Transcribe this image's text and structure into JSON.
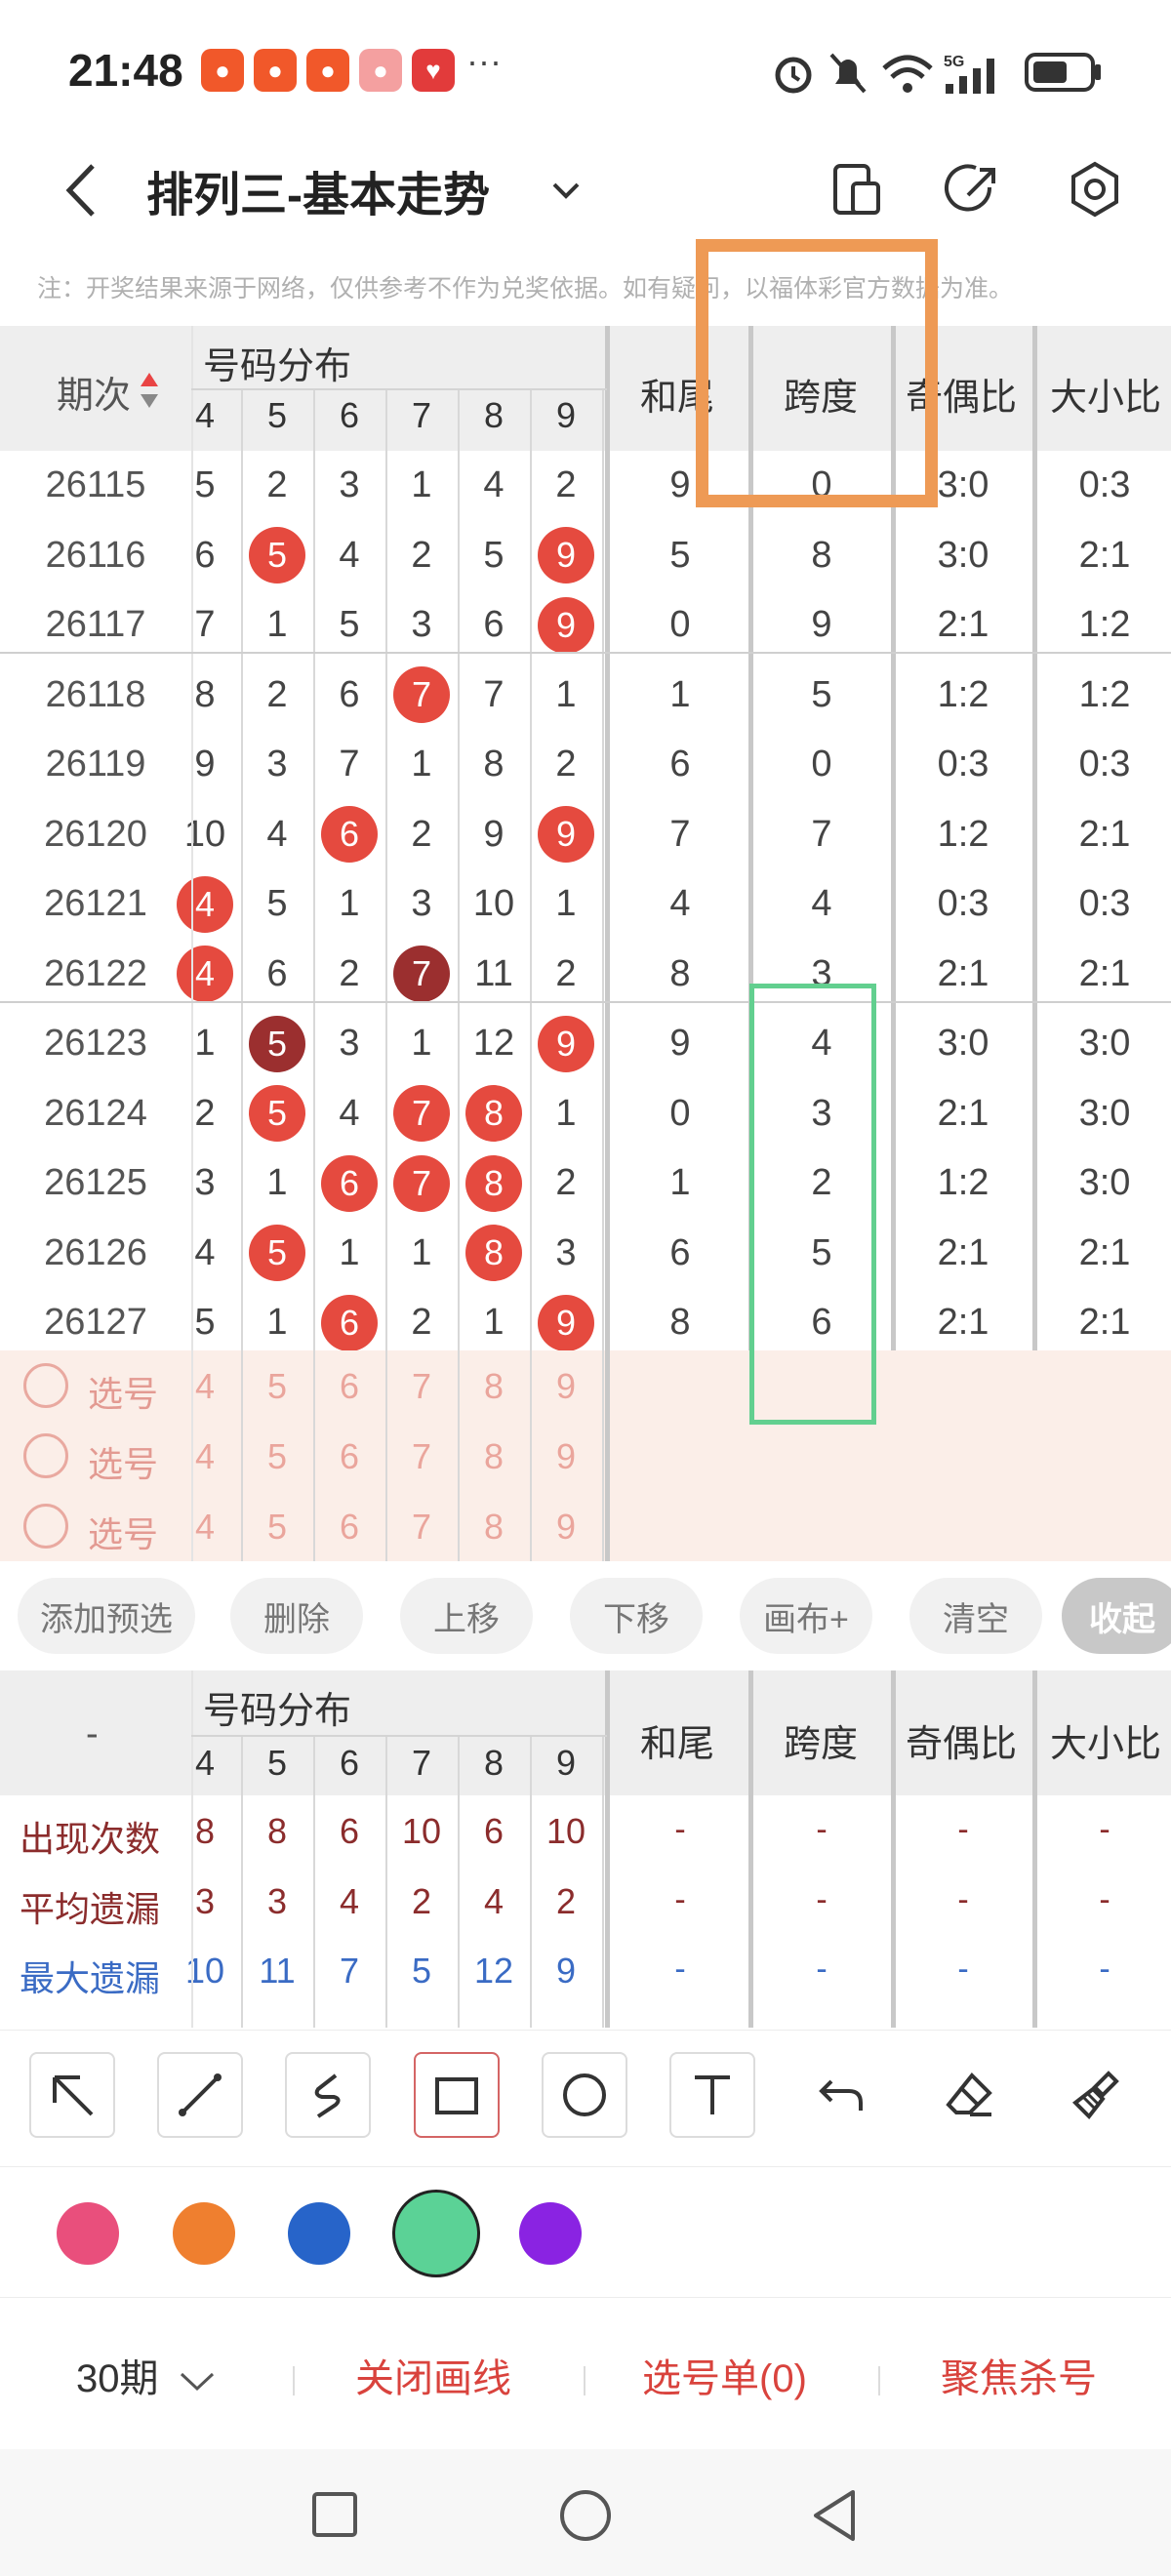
{
  "status": {
    "time": "21:48",
    "dots": "···"
  },
  "header": {
    "title": "排列三-基本走势"
  },
  "note": "注：开奖结果来源于网络，仅供参考不作为兑奖依据。如有疑问，以福体彩官方数据为准。",
  "table": {
    "period_header": "期次",
    "dist_header": "号码分布",
    "digit_headers": [
      "4",
      "5",
      "6",
      "7",
      "8",
      "9"
    ],
    "col_headers": [
      "和尾",
      "跨度",
      "奇偶比",
      "大小比"
    ],
    "rows": [
      {
        "period": "26115",
        "d": [
          "5",
          "2",
          "3",
          "1",
          "4",
          "2"
        ],
        "balls": [],
        "hw": "9",
        "kd": "0",
        "jo": "3:0",
        "dx": "0:3"
      },
      {
        "period": "26116",
        "d": [
          "6",
          "5",
          "4",
          "2",
          "5",
          "9"
        ],
        "balls": [
          1,
          5
        ],
        "hw": "5",
        "kd": "8",
        "jo": "3:0",
        "dx": "2:1"
      },
      {
        "period": "26117",
        "d": [
          "7",
          "1",
          "5",
          "3",
          "6",
          "9"
        ],
        "balls": [
          5
        ],
        "hw": "0",
        "kd": "9",
        "jo": "2:1",
        "dx": "1:2"
      },
      {
        "period": "26118",
        "d": [
          "8",
          "2",
          "6",
          "7",
          "7",
          "1"
        ],
        "balls": [
          3
        ],
        "hw": "1",
        "kd": "5",
        "jo": "1:2",
        "dx": "1:2"
      },
      {
        "period": "26119",
        "d": [
          "9",
          "3",
          "7",
          "1",
          "8",
          "2"
        ],
        "balls": [],
        "hw": "6",
        "kd": "0",
        "jo": "0:3",
        "dx": "0:3"
      },
      {
        "period": "26120",
        "d": [
          "10",
          "4",
          "6",
          "2",
          "9",
          "9"
        ],
        "balls": [
          2,
          5
        ],
        "hw": "7",
        "kd": "7",
        "jo": "1:2",
        "dx": "2:1"
      },
      {
        "period": "26121",
        "d": [
          "4",
          "5",
          "1",
          "3",
          "10",
          "1"
        ],
        "balls": [
          0
        ],
        "hw": "4",
        "kd": "4",
        "jo": "0:3",
        "dx": "0:3"
      },
      {
        "period": "26122",
        "d": [
          "4",
          "6",
          "2",
          "7",
          "11",
          "2"
        ],
        "balls": [
          0,
          3
        ],
        "dark": [
          3
        ],
        "hw": "8",
        "kd": "3",
        "jo": "2:1",
        "dx": "2:1"
      },
      {
        "period": "26123",
        "d": [
          "1",
          "5",
          "3",
          "1",
          "12",
          "9"
        ],
        "balls": [
          1,
          5
        ],
        "dark": [
          1
        ],
        "hw": "9",
        "kd": "4",
        "jo": "3:0",
        "dx": "3:0"
      },
      {
        "period": "26124",
        "d": [
          "2",
          "5",
          "4",
          "7",
          "8",
          "1"
        ],
        "balls": [
          1,
          3,
          4
        ],
        "hw": "0",
        "kd": "3",
        "jo": "2:1",
        "dx": "3:0"
      },
      {
        "period": "26125",
        "d": [
          "3",
          "1",
          "6",
          "7",
          "8",
          "2"
        ],
        "balls": [
          2,
          3,
          4
        ],
        "hw": "1",
        "kd": "2",
        "jo": "1:2",
        "dx": "3:0"
      },
      {
        "period": "26126",
        "d": [
          "4",
          "5",
          "1",
          "1",
          "8",
          "3"
        ],
        "balls": [
          1,
          4
        ],
        "hw": "6",
        "kd": "5",
        "jo": "2:1",
        "dx": "2:1"
      },
      {
        "period": "26127",
        "d": [
          "5",
          "1",
          "6",
          "2",
          "1",
          "9"
        ],
        "balls": [
          2,
          5
        ],
        "hw": "8",
        "kd": "6",
        "jo": "2:1",
        "dx": "2:1"
      }
    ],
    "select_label": "选号",
    "select_digits": [
      "4",
      "5",
      "6",
      "7",
      "8",
      "9"
    ]
  },
  "actions": [
    "添加预选",
    "删除",
    "上移",
    "下移",
    "画布+",
    "清空",
    "收起"
  ],
  "stats": {
    "corner": "-",
    "dist_header": "号码分布",
    "digit_headers": [
      "4",
      "5",
      "6",
      "7",
      "8",
      "9"
    ],
    "col_headers": [
      "和尾",
      "跨度",
      "奇偶比",
      "大小比"
    ],
    "rows": [
      {
        "label": "出现次数",
        "color": "#8b2c2c",
        "vals": [
          "8",
          "8",
          "6",
          "10",
          "6",
          "10"
        ],
        "dash": "-"
      },
      {
        "label": "平均遗漏",
        "color": "#8b2c2c",
        "vals": [
          "3",
          "3",
          "4",
          "2",
          "4",
          "2"
        ],
        "dash": "-"
      },
      {
        "label": "最大遗漏",
        "color": "#3a6bc4",
        "vals": [
          "10",
          "11",
          "7",
          "5",
          "12",
          "9"
        ],
        "dash": "-"
      }
    ]
  },
  "colors": {
    "swatches": [
      "#e94f7c",
      "#ef7f2f",
      "#2764c9",
      "#5bd296",
      "#8a23e2"
    ],
    "orange_box": "#ee9a55",
    "green_box": "#62cf8f",
    "accent_red": "#d9433d"
  },
  "bottom": {
    "periods": "30期",
    "close_lines": "关闭画线",
    "selection": "选号单(0)",
    "focus": "聚焦杀号"
  }
}
